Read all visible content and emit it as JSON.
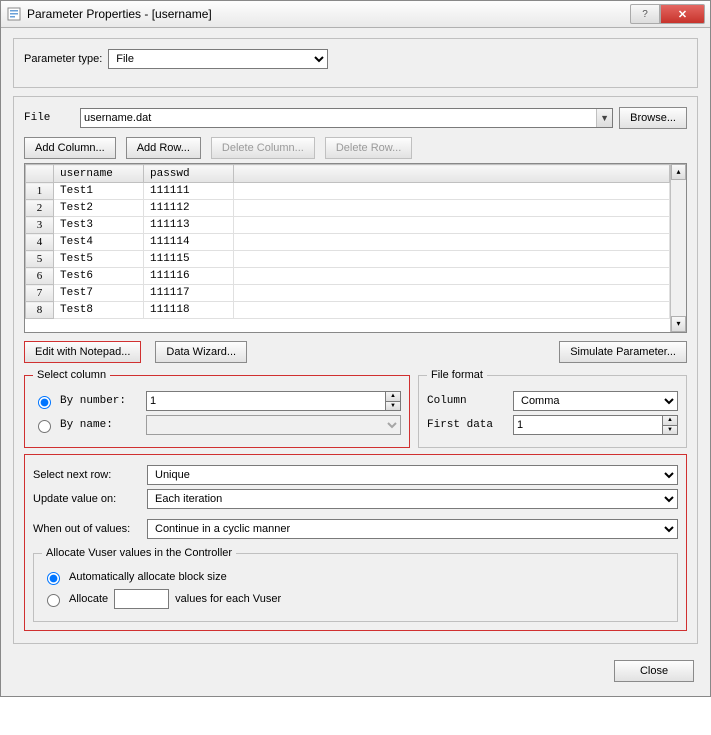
{
  "title": "Parameter Properties - [username]",
  "param_type_label": "Parameter type:",
  "param_type_value": "File",
  "file_label": "File",
  "file_value": "username.dat",
  "browse_label": "Browse...",
  "buttons": {
    "add_column": "Add Column...",
    "add_row": "Add Row...",
    "delete_column": "Delete Column...",
    "delete_row": "Delete Row...",
    "edit_notepad": "Edit with Notepad...",
    "data_wizard": "Data Wizard...",
    "simulate": "Simulate Parameter...",
    "close": "Close"
  },
  "table": {
    "columns": [
      "username",
      "passwd"
    ],
    "rows": [
      {
        "n": "1",
        "c": [
          "Test1",
          "111111"
        ]
      },
      {
        "n": "2",
        "c": [
          "Test2",
          "111112"
        ]
      },
      {
        "n": "3",
        "c": [
          "Test3",
          "111113"
        ]
      },
      {
        "n": "4",
        "c": [
          "Test4",
          "111114"
        ]
      },
      {
        "n": "5",
        "c": [
          "Test5",
          "111115"
        ]
      },
      {
        "n": "6",
        "c": [
          "Test6",
          "111116"
        ]
      },
      {
        "n": "7",
        "c": [
          "Test7",
          "111117"
        ]
      },
      {
        "n": "8",
        "c": [
          "Test8",
          "111118"
        ]
      }
    ]
  },
  "select_column": {
    "legend": "Select column",
    "by_number_label": "By number:",
    "by_number_value": "1",
    "by_name_label": "By name:",
    "by_name_value": ""
  },
  "file_format": {
    "legend": "File format",
    "column_label": "Column",
    "column_value": "Comma",
    "first_data_label": "First data",
    "first_data_value": "1"
  },
  "next_row": {
    "select_next_label": "Select next row:",
    "select_next_value": "Unique",
    "update_label": "Update value on:",
    "update_value": "Each iteration",
    "out_label": "When out of values:",
    "out_value": "Continue in a cyclic manner"
  },
  "allocate": {
    "legend": "Allocate Vuser values in the Controller",
    "auto_label": "Automatically allocate block size",
    "alloc_label": "Allocate",
    "alloc_suffix": "values for each Vuser",
    "alloc_value": ""
  }
}
